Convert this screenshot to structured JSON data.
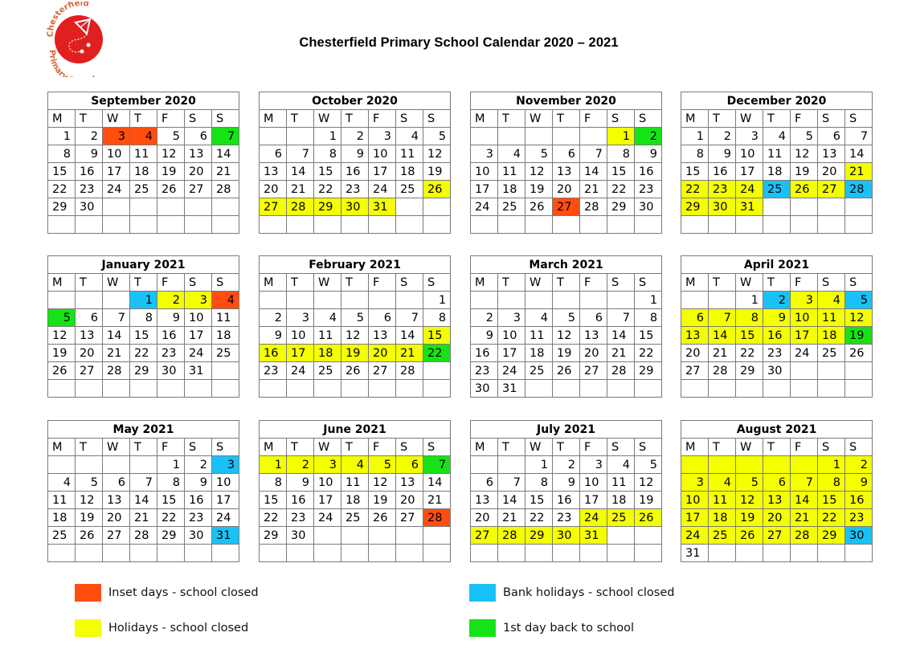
{
  "header": {
    "title": "Chesterfield Primary School Calendar 2020 – 2021",
    "logo": {
      "top_text": "Chesterfield",
      "bottom_text": "Primary School",
      "icon": "kite-icon"
    }
  },
  "colors": {
    "inset": "#ff4e0f",
    "holiday": "#f4ff00",
    "bank": "#1ac1f7",
    "back": "#16e316"
  },
  "weekday_headers": [
    "M",
    "T",
    "W",
    "T",
    "F",
    "S",
    "S"
  ],
  "months": [
    {
      "name": "September 2020",
      "offset": 1,
      "days": 30,
      "rows": 6,
      "marks": {
        "3": "inset",
        "4": "inset",
        "7": "back"
      }
    },
    {
      "name": "October 2020",
      "offset": 3,
      "days": 31,
      "rows": 6,
      "marks": {
        "26": "holiday",
        "27": "holiday",
        "28": "holiday",
        "29": "holiday",
        "30": "holiday",
        "31": "holiday"
      }
    },
    {
      "name": "November 2020",
      "offset": 6,
      "days": 30,
      "rows": 6,
      "marks": {
        "1": "holiday",
        "2": "back",
        "27": "inset"
      }
    },
    {
      "name": "December 2020",
      "offset": 1,
      "days": 31,
      "rows": 6,
      "marks": {
        "21": "holiday",
        "22": "holiday",
        "23": "holiday",
        "24": "holiday",
        "25": "bank",
        "26": "holiday",
        "27": "holiday",
        "28": "bank",
        "29": "holiday",
        "30": "holiday",
        "31": "holiday"
      }
    },
    {
      "name": "January 2021",
      "offset": 4,
      "days": 31,
      "rows": 6,
      "marks": {
        "1": "bank",
        "2": "holiday",
        "3": "holiday",
        "4": "inset",
        "5": "back"
      }
    },
    {
      "name": "February 2021",
      "offset": 7,
      "days": 28,
      "rows": 6,
      "marks": {
        "15": "holiday",
        "16": "holiday",
        "17": "holiday",
        "18": "holiday",
        "19": "holiday",
        "20": "holiday",
        "21": "holiday",
        "22": "back"
      }
    },
    {
      "name": "March 2021",
      "offset": 7,
      "days": 31,
      "rows": 6,
      "marks": {}
    },
    {
      "name": "April 2021",
      "offset": 3,
      "days": 30,
      "rows": 6,
      "marks": {
        "2": "bank",
        "3": "holiday",
        "4": "holiday",
        "5": "bank",
        "6": "holiday",
        "7": "holiday",
        "8": "holiday",
        "9": "holiday",
        "10": "holiday",
        "11": "holiday",
        "12": "holiday",
        "13": "holiday",
        "14": "holiday",
        "15": "holiday",
        "16": "holiday",
        "17": "holiday",
        "18": "holiday",
        "19": "back"
      }
    },
    {
      "name": "May 2021",
      "offset": 5,
      "days": 31,
      "rows": 6,
      "marks": {
        "3": "bank",
        "31": "bank"
      }
    },
    {
      "name": "June 2021",
      "offset": 1,
      "days": 30,
      "rows": 6,
      "marks": {
        "1": "holiday",
        "2": "holiday",
        "3": "holiday",
        "4": "holiday",
        "5": "holiday",
        "6": "holiday",
        "7": "back",
        "28": "inset"
      }
    },
    {
      "name": "July 2021",
      "offset": 3,
      "days": 31,
      "rows": 6,
      "marks": {
        "24": "holiday",
        "25": "holiday",
        "26": "holiday",
        "27": "holiday",
        "28": "holiday",
        "29": "holiday",
        "30": "holiday",
        "31": "holiday"
      }
    },
    {
      "name": "August 2021",
      "offset": 6,
      "days": 31,
      "rows": 6,
      "marks": {
        "1": "holiday",
        "2": "holiday",
        "3": "holiday",
        "4": "holiday",
        "5": "holiday",
        "6": "holiday",
        "7": "holiday",
        "8": "holiday",
        "9": "holiday",
        "10": "holiday",
        "11": "holiday",
        "12": "holiday",
        "13": "holiday",
        "14": "holiday",
        "15": "holiday",
        "16": "holiday",
        "17": "holiday",
        "18": "holiday",
        "19": "holiday",
        "20": "holiday",
        "21": "holiday",
        "22": "holiday",
        "23": "holiday",
        "24": "holiday",
        "25": "holiday",
        "26": "holiday",
        "27": "holiday",
        "28": "holiday",
        "29": "holiday",
        "30": "bank"
      },
      "blank_first_row_mark": "holiday"
    }
  ],
  "legend": [
    {
      "key": "inset",
      "label": "Inset days - school closed"
    },
    {
      "key": "holiday",
      "label": "Holidays - school closed"
    },
    {
      "key": "bank",
      "label": "Bank holidays - school closed"
    },
    {
      "key": "back",
      "label": "1st day back to school"
    }
  ]
}
